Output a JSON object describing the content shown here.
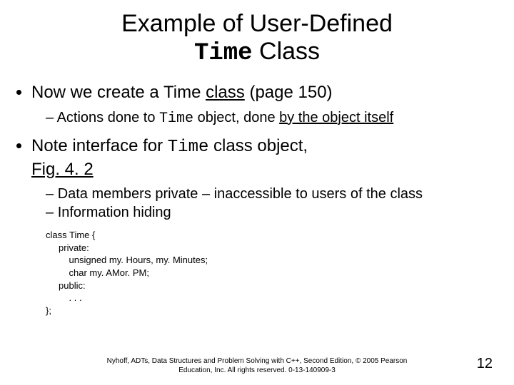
{
  "title": {
    "line1_pre": "Example of User-Defined",
    "line2_time": "Time",
    "line2_post": " Class"
  },
  "bullets": {
    "b1_pre": "Now we create a Time ",
    "b1_u": "class",
    "b1_post": " (page 150)",
    "b1_sub_pre": "Actions done to ",
    "b1_sub_time": "Time",
    "b1_sub_mid": " object, done ",
    "b1_sub_u": "by the object itself",
    "b2_pre": "Note interface for ",
    "b2_time": "Time",
    "b2_post": " class object, ",
    "b2_u": "Fig. 4. 2",
    "b2_sub1": "Data members private – inaccessible to users of the class",
    "b2_sub2": "Information hiding"
  },
  "code": "class Time {\n     private:\n         unsigned my. Hours, my. Minutes;\n         char my. AMor. PM;\n     public:\n         . . .\n};",
  "footer": {
    "line1": "Nyhoff, ADTs, Data Structures and Problem Solving with C++, Second Edition, © 2005 Pearson",
    "line2": "Education, Inc. All rights reserved. 0-13-140909-3"
  },
  "pagenum": "12"
}
